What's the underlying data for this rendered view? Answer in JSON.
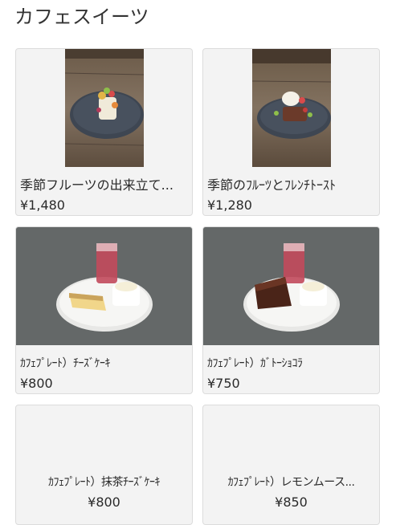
{
  "section_title": "カフェスイーツ",
  "items": [
    {
      "name": "季節フルーツの出来立て...",
      "price": "¥1,480"
    },
    {
      "name": "季節のﾌﾙｰﾂとﾌﾚﾝﾁﾄｰｽﾄ",
      "price": "¥1,280"
    },
    {
      "name": "ｶﾌｪﾌﾟﾚｰﾄ）ﾁｰｽﾞｹｰｷ",
      "price": "¥800"
    },
    {
      "name": "ｶﾌｪﾌﾟﾚｰﾄ）ｶﾞﾄｰｼｮｺﾗ",
      "price": "¥750"
    },
    {
      "name": "ｶﾌｪﾌﾟﾚｰﾄ）抹茶ﾁｰｽﾞｹｰｷ",
      "price": "¥800"
    },
    {
      "name": "ｶﾌｪﾌﾟﾚｰﾄ）レモンムース...",
      "price": "¥850"
    }
  ]
}
